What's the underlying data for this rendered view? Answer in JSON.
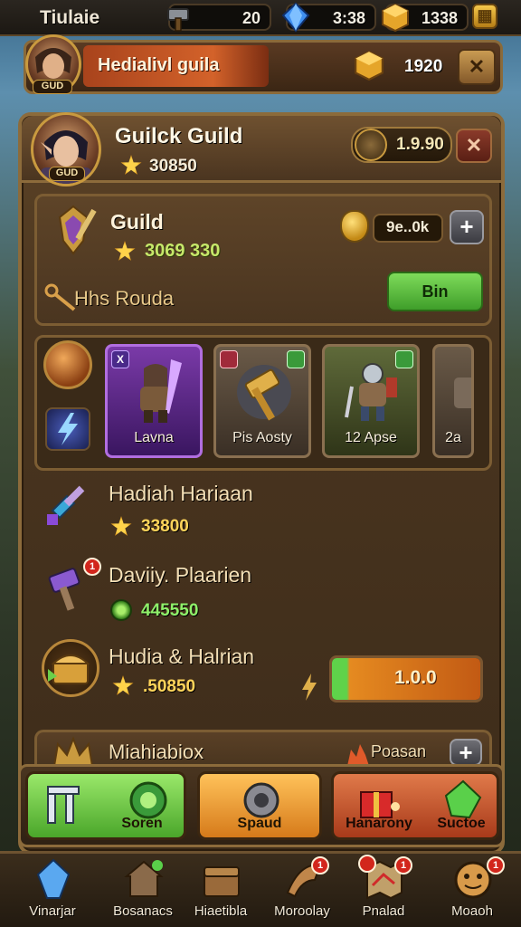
{
  "topbar": {
    "title": "Tiulaie",
    "resources": [
      {
        "icon": "hammer-icon",
        "value": "20"
      },
      {
        "icon": "blue-gem-icon",
        "value": "3:38"
      },
      {
        "icon": "gold-cube-icon",
        "value": "1338"
      }
    ]
  },
  "quest_bar": {
    "title": "Hedialivl guila",
    "value": "1920",
    "avatar_level": "GUD"
  },
  "header": {
    "guild_name": "Guilck Guild",
    "score": "30850",
    "avatar_level": "GUD",
    "pill_value": "1.9.90"
  },
  "guild_card": {
    "title": "Guild",
    "score": "3069 330",
    "pill_value": "9e..0k",
    "subtitle": "Hhs Rouda",
    "button_label": "Bin"
  },
  "heroes": [
    {
      "label": "Lavna",
      "style": "purple",
      "badge": "X"
    },
    {
      "label": "Pis Aosty",
      "style": "stone",
      "badge": ""
    },
    {
      "label": "12 Apse",
      "style": "green",
      "badge": ""
    },
    {
      "label": "2a",
      "style": "stone",
      "badge": ""
    }
  ],
  "rows": [
    {
      "title": "Hadiah Hariaan",
      "value": "33800",
      "value_color": "#ffd45a",
      "icon": "crystal-sword-icon",
      "value_icon": "star-icon",
      "badge": ""
    },
    {
      "title": "Daviiy. Plaarien",
      "value": "445550",
      "value_color": "#8ff06a",
      "icon": "crystal-hammer-icon",
      "value_icon": "green-orb-icon",
      "badge": "1"
    },
    {
      "title": "Hudia & Halrian",
      "value": ".50850",
      "value_color": "#ffd45a",
      "icon": "treasure-chest-icon",
      "value_icon": "star-icon",
      "badge": ""
    }
  ],
  "progress": {
    "value_text": "1.0.0",
    "fraction": 0.1
  },
  "partial_row": {
    "title": "Miahiabiox",
    "value": "Poasan"
  },
  "actions": [
    {
      "label": "Soren",
      "color": "#7fd24e"
    },
    {
      "label": "Spaud",
      "color": "#f0a03a"
    },
    {
      "label": "Hanarony",
      "color": "#d05a2a"
    },
    {
      "label": "Suctoe",
      "color": "#d05a2a"
    }
  ],
  "nav": [
    {
      "label": "Vinarjar",
      "icon": "blue-crystal-icon",
      "badge": ""
    },
    {
      "label": "Bosanacs",
      "icon": "house-icon",
      "badge": ""
    },
    {
      "label": "Hiaetibla",
      "icon": "chest-icon",
      "badge": ""
    },
    {
      "label": "Moroolay",
      "icon": "horn-icon",
      "badge": "1"
    },
    {
      "label": "Pnalad",
      "icon": "map-icon",
      "badge": "1"
    },
    {
      "label": "Moaoh",
      "icon": "face-icon",
      "badge": "1"
    }
  ]
}
